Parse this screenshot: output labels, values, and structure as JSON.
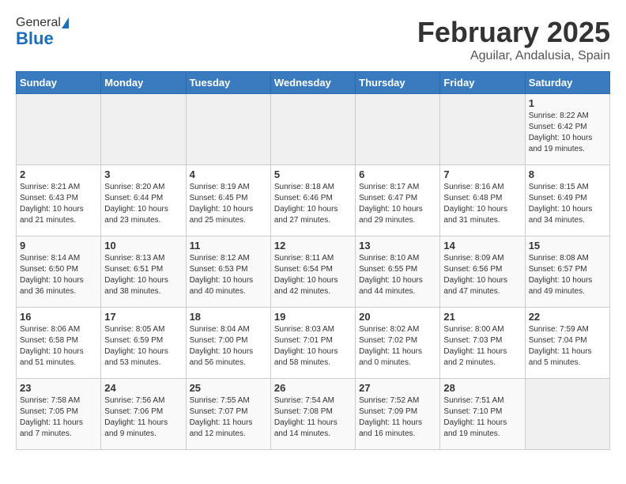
{
  "header": {
    "logo_general": "General",
    "logo_blue": "Blue",
    "title": "February 2025",
    "subtitle": "Aguilar, Andalusia, Spain"
  },
  "columns": [
    "Sunday",
    "Monday",
    "Tuesday",
    "Wednesday",
    "Thursday",
    "Friday",
    "Saturday"
  ],
  "weeks": [
    [
      {
        "day": "",
        "info": ""
      },
      {
        "day": "",
        "info": ""
      },
      {
        "day": "",
        "info": ""
      },
      {
        "day": "",
        "info": ""
      },
      {
        "day": "",
        "info": ""
      },
      {
        "day": "",
        "info": ""
      },
      {
        "day": "1",
        "info": "Sunrise: 8:22 AM\nSunset: 6:42 PM\nDaylight: 10 hours and 19 minutes."
      }
    ],
    [
      {
        "day": "2",
        "info": "Sunrise: 8:21 AM\nSunset: 6:43 PM\nDaylight: 10 hours and 21 minutes."
      },
      {
        "day": "3",
        "info": "Sunrise: 8:20 AM\nSunset: 6:44 PM\nDaylight: 10 hours and 23 minutes."
      },
      {
        "day": "4",
        "info": "Sunrise: 8:19 AM\nSunset: 6:45 PM\nDaylight: 10 hours and 25 minutes."
      },
      {
        "day": "5",
        "info": "Sunrise: 8:18 AM\nSunset: 6:46 PM\nDaylight: 10 hours and 27 minutes."
      },
      {
        "day": "6",
        "info": "Sunrise: 8:17 AM\nSunset: 6:47 PM\nDaylight: 10 hours and 29 minutes."
      },
      {
        "day": "7",
        "info": "Sunrise: 8:16 AM\nSunset: 6:48 PM\nDaylight: 10 hours and 31 minutes."
      },
      {
        "day": "8",
        "info": "Sunrise: 8:15 AM\nSunset: 6:49 PM\nDaylight: 10 hours and 34 minutes."
      }
    ],
    [
      {
        "day": "9",
        "info": "Sunrise: 8:14 AM\nSunset: 6:50 PM\nDaylight: 10 hours and 36 minutes."
      },
      {
        "day": "10",
        "info": "Sunrise: 8:13 AM\nSunset: 6:51 PM\nDaylight: 10 hours and 38 minutes."
      },
      {
        "day": "11",
        "info": "Sunrise: 8:12 AM\nSunset: 6:53 PM\nDaylight: 10 hours and 40 minutes."
      },
      {
        "day": "12",
        "info": "Sunrise: 8:11 AM\nSunset: 6:54 PM\nDaylight: 10 hours and 42 minutes."
      },
      {
        "day": "13",
        "info": "Sunrise: 8:10 AM\nSunset: 6:55 PM\nDaylight: 10 hours and 44 minutes."
      },
      {
        "day": "14",
        "info": "Sunrise: 8:09 AM\nSunset: 6:56 PM\nDaylight: 10 hours and 47 minutes."
      },
      {
        "day": "15",
        "info": "Sunrise: 8:08 AM\nSunset: 6:57 PM\nDaylight: 10 hours and 49 minutes."
      }
    ],
    [
      {
        "day": "16",
        "info": "Sunrise: 8:06 AM\nSunset: 6:58 PM\nDaylight: 10 hours and 51 minutes."
      },
      {
        "day": "17",
        "info": "Sunrise: 8:05 AM\nSunset: 6:59 PM\nDaylight: 10 hours and 53 minutes."
      },
      {
        "day": "18",
        "info": "Sunrise: 8:04 AM\nSunset: 7:00 PM\nDaylight: 10 hours and 56 minutes."
      },
      {
        "day": "19",
        "info": "Sunrise: 8:03 AM\nSunset: 7:01 PM\nDaylight: 10 hours and 58 minutes."
      },
      {
        "day": "20",
        "info": "Sunrise: 8:02 AM\nSunset: 7:02 PM\nDaylight: 11 hours and 0 minutes."
      },
      {
        "day": "21",
        "info": "Sunrise: 8:00 AM\nSunset: 7:03 PM\nDaylight: 11 hours and 2 minutes."
      },
      {
        "day": "22",
        "info": "Sunrise: 7:59 AM\nSunset: 7:04 PM\nDaylight: 11 hours and 5 minutes."
      }
    ],
    [
      {
        "day": "23",
        "info": "Sunrise: 7:58 AM\nSunset: 7:05 PM\nDaylight: 11 hours and 7 minutes."
      },
      {
        "day": "24",
        "info": "Sunrise: 7:56 AM\nSunset: 7:06 PM\nDaylight: 11 hours and 9 minutes."
      },
      {
        "day": "25",
        "info": "Sunrise: 7:55 AM\nSunset: 7:07 PM\nDaylight: 11 hours and 12 minutes."
      },
      {
        "day": "26",
        "info": "Sunrise: 7:54 AM\nSunset: 7:08 PM\nDaylight: 11 hours and 14 minutes."
      },
      {
        "day": "27",
        "info": "Sunrise: 7:52 AM\nSunset: 7:09 PM\nDaylight: 11 hours and 16 minutes."
      },
      {
        "day": "28",
        "info": "Sunrise: 7:51 AM\nSunset: 7:10 PM\nDaylight: 11 hours and 19 minutes."
      },
      {
        "day": "",
        "info": ""
      }
    ]
  ]
}
